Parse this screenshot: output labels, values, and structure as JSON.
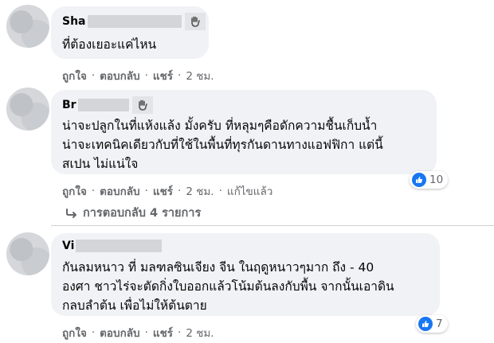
{
  "comments": [
    {
      "author": "Sha",
      "text": "ที่ต้องเยอะแค่ไหน",
      "actions": {
        "like": "ถูกใจ",
        "reply": "ตอบกลับ",
        "share": "แชร์",
        "time": "2 ชม."
      }
    },
    {
      "author": "Br",
      "text": "น่าจะปลูกในที่แห้งแล้ง มั้งครับ ที่หลุมๆคือดักความชื้นเก็บน้ำ\nน่าจะเทคนิคเดียวกับที่ใช้ในพื้นที่ทุรกันดานทางแอฟฟิกา แต่นี้\nสเปน ไม่แน่ใจ",
      "actions": {
        "like": "ถูกใจ",
        "reply": "ตอบกลับ",
        "share": "แชร์",
        "time": "2 ชม.",
        "edited": "แก้ไขแล้ว"
      },
      "reaction_count": "10"
    },
    {
      "author": "Vi",
      "text": "กันลมหนาว ที่ มลฑลซินเจียง จีน ในฤดูหนาวๆมาก ถึง - 40\nองศา ชาวไร่จะตัดกิ่งใบออกแล้วโน้มต้นลงกับพื้น จากนั้นเอาดิน\nกลบลำต้น เพื่อไม่ให้ต้นตาย",
      "actions": {
        "like": "ถูกใจ",
        "reply": "ตอบกลับ",
        "share": "แชร์",
        "time": "2 ชม."
      },
      "reaction_count": "7"
    }
  ],
  "replies_link": "การตอบกลับ 4 รายการ",
  "colors": {
    "bubble": "#f0f2f5",
    "meta": "#65676b",
    "like_blue": "#1877f2"
  }
}
